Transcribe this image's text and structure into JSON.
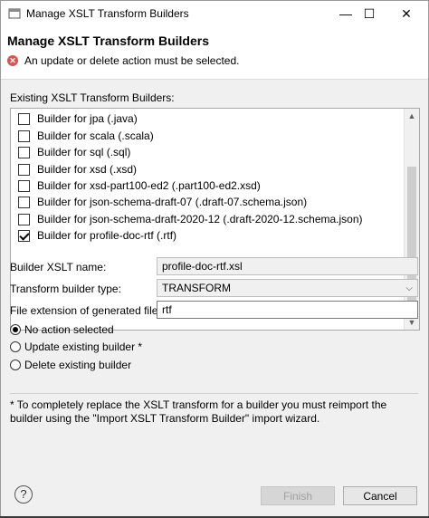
{
  "window": {
    "title": "Manage XSLT Transform Builders",
    "minimize": "—",
    "maximize": "☐",
    "close": "✕"
  },
  "header": {
    "title": "Manage XSLT Transform Builders",
    "error_message": "An update or delete action must be selected."
  },
  "builders": {
    "label": "Existing XSLT Transform Builders:",
    "items": [
      {
        "label": "Builder for jpa  (.java)",
        "checked": false
      },
      {
        "label": "Builder for scala  (.scala)",
        "checked": false
      },
      {
        "label": "Builder for sql  (.sql)",
        "checked": false
      },
      {
        "label": "Builder for xsd  (.xsd)",
        "checked": false
      },
      {
        "label": "Builder for xsd-part100-ed2  (.part100-ed2.xsd)",
        "checked": false
      },
      {
        "label": "Builder for json-schema-draft-07  (.draft-07.schema.json)",
        "checked": false
      },
      {
        "label": "Builder for json-schema-draft-2020-12  (.draft-2020-12.schema.json)",
        "checked": false
      },
      {
        "label": "Builder for profile-doc-rtf  (.rtf)",
        "checked": true
      }
    ]
  },
  "form": {
    "xslt_name_label": "Builder XSLT name:",
    "xslt_name_value": "profile-doc-rtf.xsl",
    "type_label": "Transform builder type:",
    "type_value": "TRANSFORM",
    "ext_label": "File extension of generated files:",
    "ext_value": "rtf"
  },
  "actions": {
    "options": [
      {
        "label": "No action selected",
        "selected": true
      },
      {
        "label": "Update existing builder *",
        "selected": false
      },
      {
        "label": "Delete existing builder",
        "selected": false
      }
    ]
  },
  "note": "* To completely replace the XSLT transform for a builder you must reimport the builder using the \"Import XSLT Transform Builder\" import wizard.",
  "footer": {
    "finish_label": "Finish",
    "cancel_label": "Cancel",
    "help_symbol": "?"
  }
}
